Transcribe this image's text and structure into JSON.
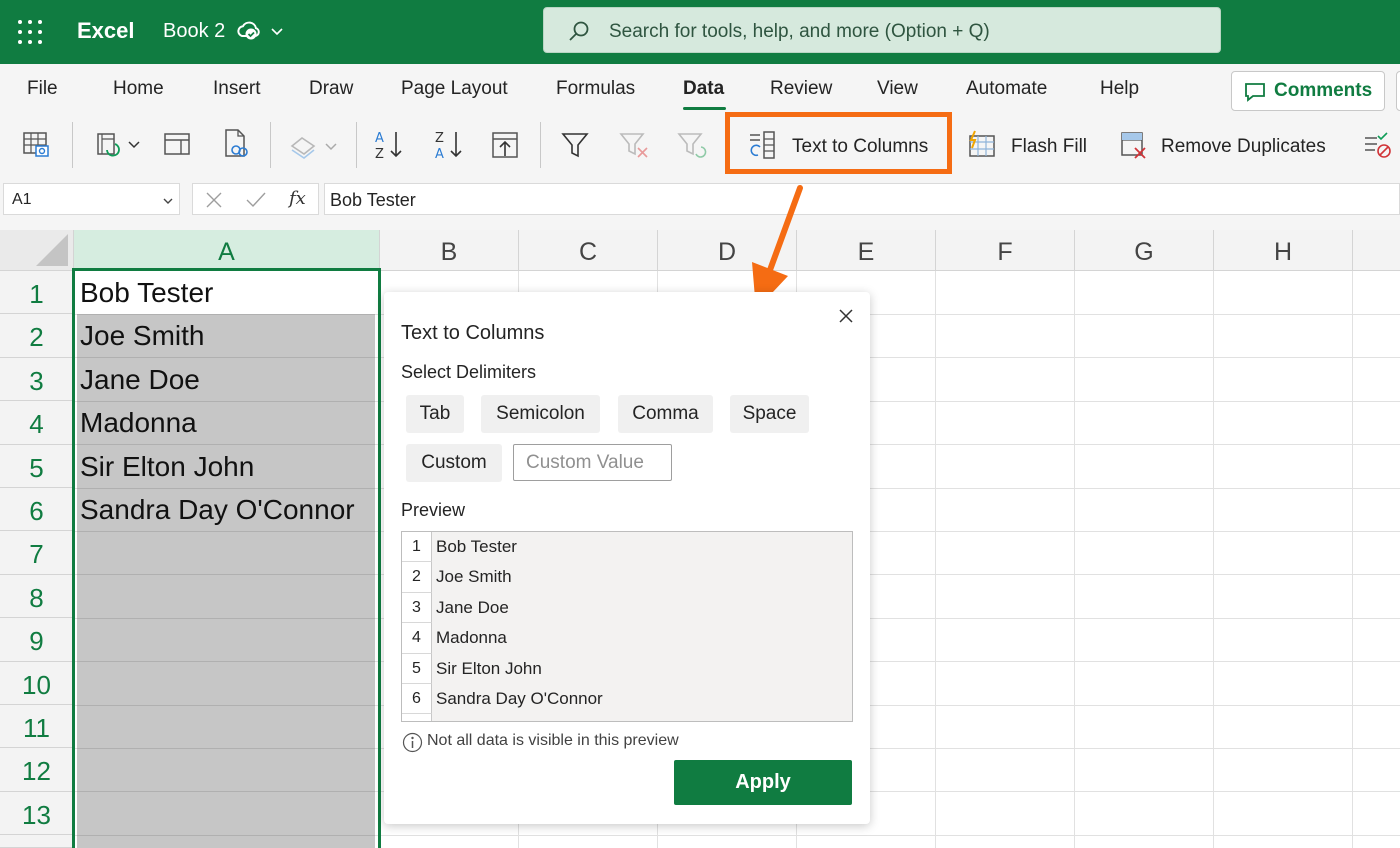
{
  "titlebar": {
    "app_name": "Excel",
    "book_name": "Book 2",
    "search_placeholder": "Search for tools, help, and more (Option + Q)"
  },
  "ribbon": {
    "tabs": [
      "File",
      "Home",
      "Insert",
      "Draw",
      "Page Layout",
      "Formulas",
      "Data",
      "Review",
      "View",
      "Automate",
      "Help"
    ],
    "active_tab": "Data",
    "comments_label": "Comments",
    "text_to_columns_label": "Text to Columns",
    "flash_fill_label": "Flash Fill",
    "remove_duplicates_label": "Remove Duplicates"
  },
  "formula_bar": {
    "name_box": "A1",
    "fx_label": "fx",
    "formula": "Bob Tester"
  },
  "grid": {
    "columns": [
      "A",
      "B",
      "C",
      "D",
      "E",
      "F",
      "G",
      "H"
    ],
    "rows": [
      "1",
      "2",
      "3",
      "4",
      "5",
      "6",
      "7",
      "8",
      "9",
      "10",
      "11",
      "12",
      "13"
    ],
    "column_a_values": [
      "Bob Tester",
      "Joe Smith",
      "Jane Doe",
      "Madonna",
      "Sir Elton John",
      "Sandra Day O'Connor"
    ]
  },
  "dialog": {
    "title": "Text to Columns",
    "delimiters_heading": "Select Delimiters",
    "delimiters": [
      "Tab",
      "Semicolon",
      "Comma",
      "Space",
      "Custom"
    ],
    "custom_placeholder": "Custom Value",
    "preview_heading": "Preview",
    "preview_rows": [
      {
        "num": "1",
        "value": "Bob Tester"
      },
      {
        "num": "2",
        "value": "Joe Smith"
      },
      {
        "num": "3",
        "value": "Jane Doe"
      },
      {
        "num": "4",
        "value": "Madonna"
      },
      {
        "num": "5",
        "value": "Sir Elton John"
      },
      {
        "num": "6",
        "value": "Sandra Day O'Connor"
      }
    ],
    "info_text": "Not all data is visible in this preview",
    "apply_label": "Apply"
  },
  "colors": {
    "brand_green": "#107c41",
    "highlight_orange": "#f56c13",
    "selection_gray": "#c6c6c6"
  }
}
